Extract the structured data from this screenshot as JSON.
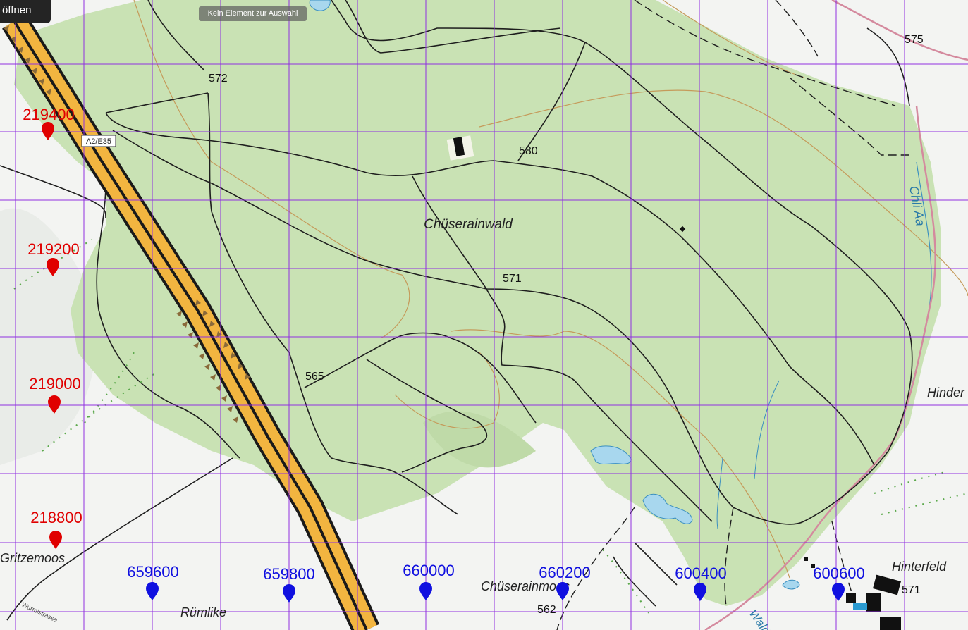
{
  "toolbar": {
    "open_label": "öffnen",
    "selection_status": "Kein Element zur Auswahl"
  },
  "map": {
    "road_label": "A2/E35",
    "forest_name": "Chüserainwald",
    "places": [
      "Hinder",
      "Gritzemoos",
      "Rümlike",
      "Hinterfeld"
    ],
    "creek_name": "Chli Aa",
    "lower_place": "Chüserainmoos",
    "street_label": "Wurmistrasse",
    "wald_label": "Wald",
    "spot_heights": [
      "572",
      "580",
      "571",
      "565",
      "575",
      "562",
      "571"
    ],
    "colors": {
      "forest": "#c9e2b4",
      "highway": "#f2b540",
      "grid": "#9030e0",
      "north_marker": "#e00000",
      "east_marker": "#1010e0"
    }
  },
  "grid": {
    "north_markers": [
      "219400",
      "219200",
      "219000",
      "218800"
    ],
    "east_markers": [
      "659600",
      "659800",
      "660000",
      "660200",
      "600400",
      "600600"
    ]
  }
}
